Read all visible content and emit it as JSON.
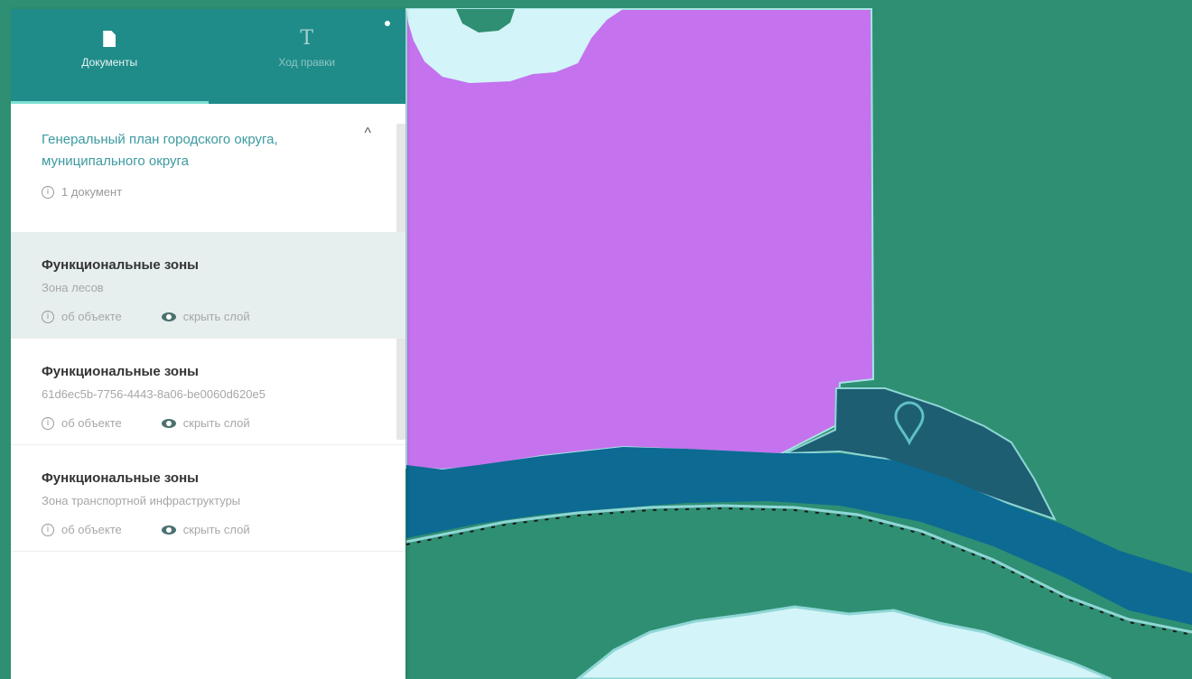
{
  "tabs": [
    {
      "label": "Документы",
      "icon": "document-icon",
      "active": true
    },
    {
      "label": "Ход правки",
      "icon": "text-icon",
      "active": false
    }
  ],
  "document": {
    "title": "Генеральный план городского округа, муниципального округа",
    "info": "1 документ",
    "collapse_glyph": "^"
  },
  "items": [
    {
      "title": "Функциональные зоны",
      "subtitle": "Зона лесов",
      "info": "об объекте",
      "hide": "скрыть слой",
      "selected": true
    },
    {
      "title": "Функциональные зоны",
      "subtitle": "61d6ec5b-7756-4443-8a06-be0060d620e5",
      "info": "об объекте",
      "hide": "скрыть слой",
      "selected": false
    },
    {
      "title": "Функциональные зоны",
      "subtitle": "Зона транспортной инфраструктуры",
      "info": "об объекте",
      "hide": "скрыть слой",
      "selected": false
    }
  ],
  "colors": {
    "header": "#1f8c89",
    "zone_forest": "#2f8f72",
    "zone_purple": "#c472ee",
    "water_dark": "#0c6a93",
    "water_light": "#d3f4f8",
    "marker": "#5fc0c5"
  }
}
